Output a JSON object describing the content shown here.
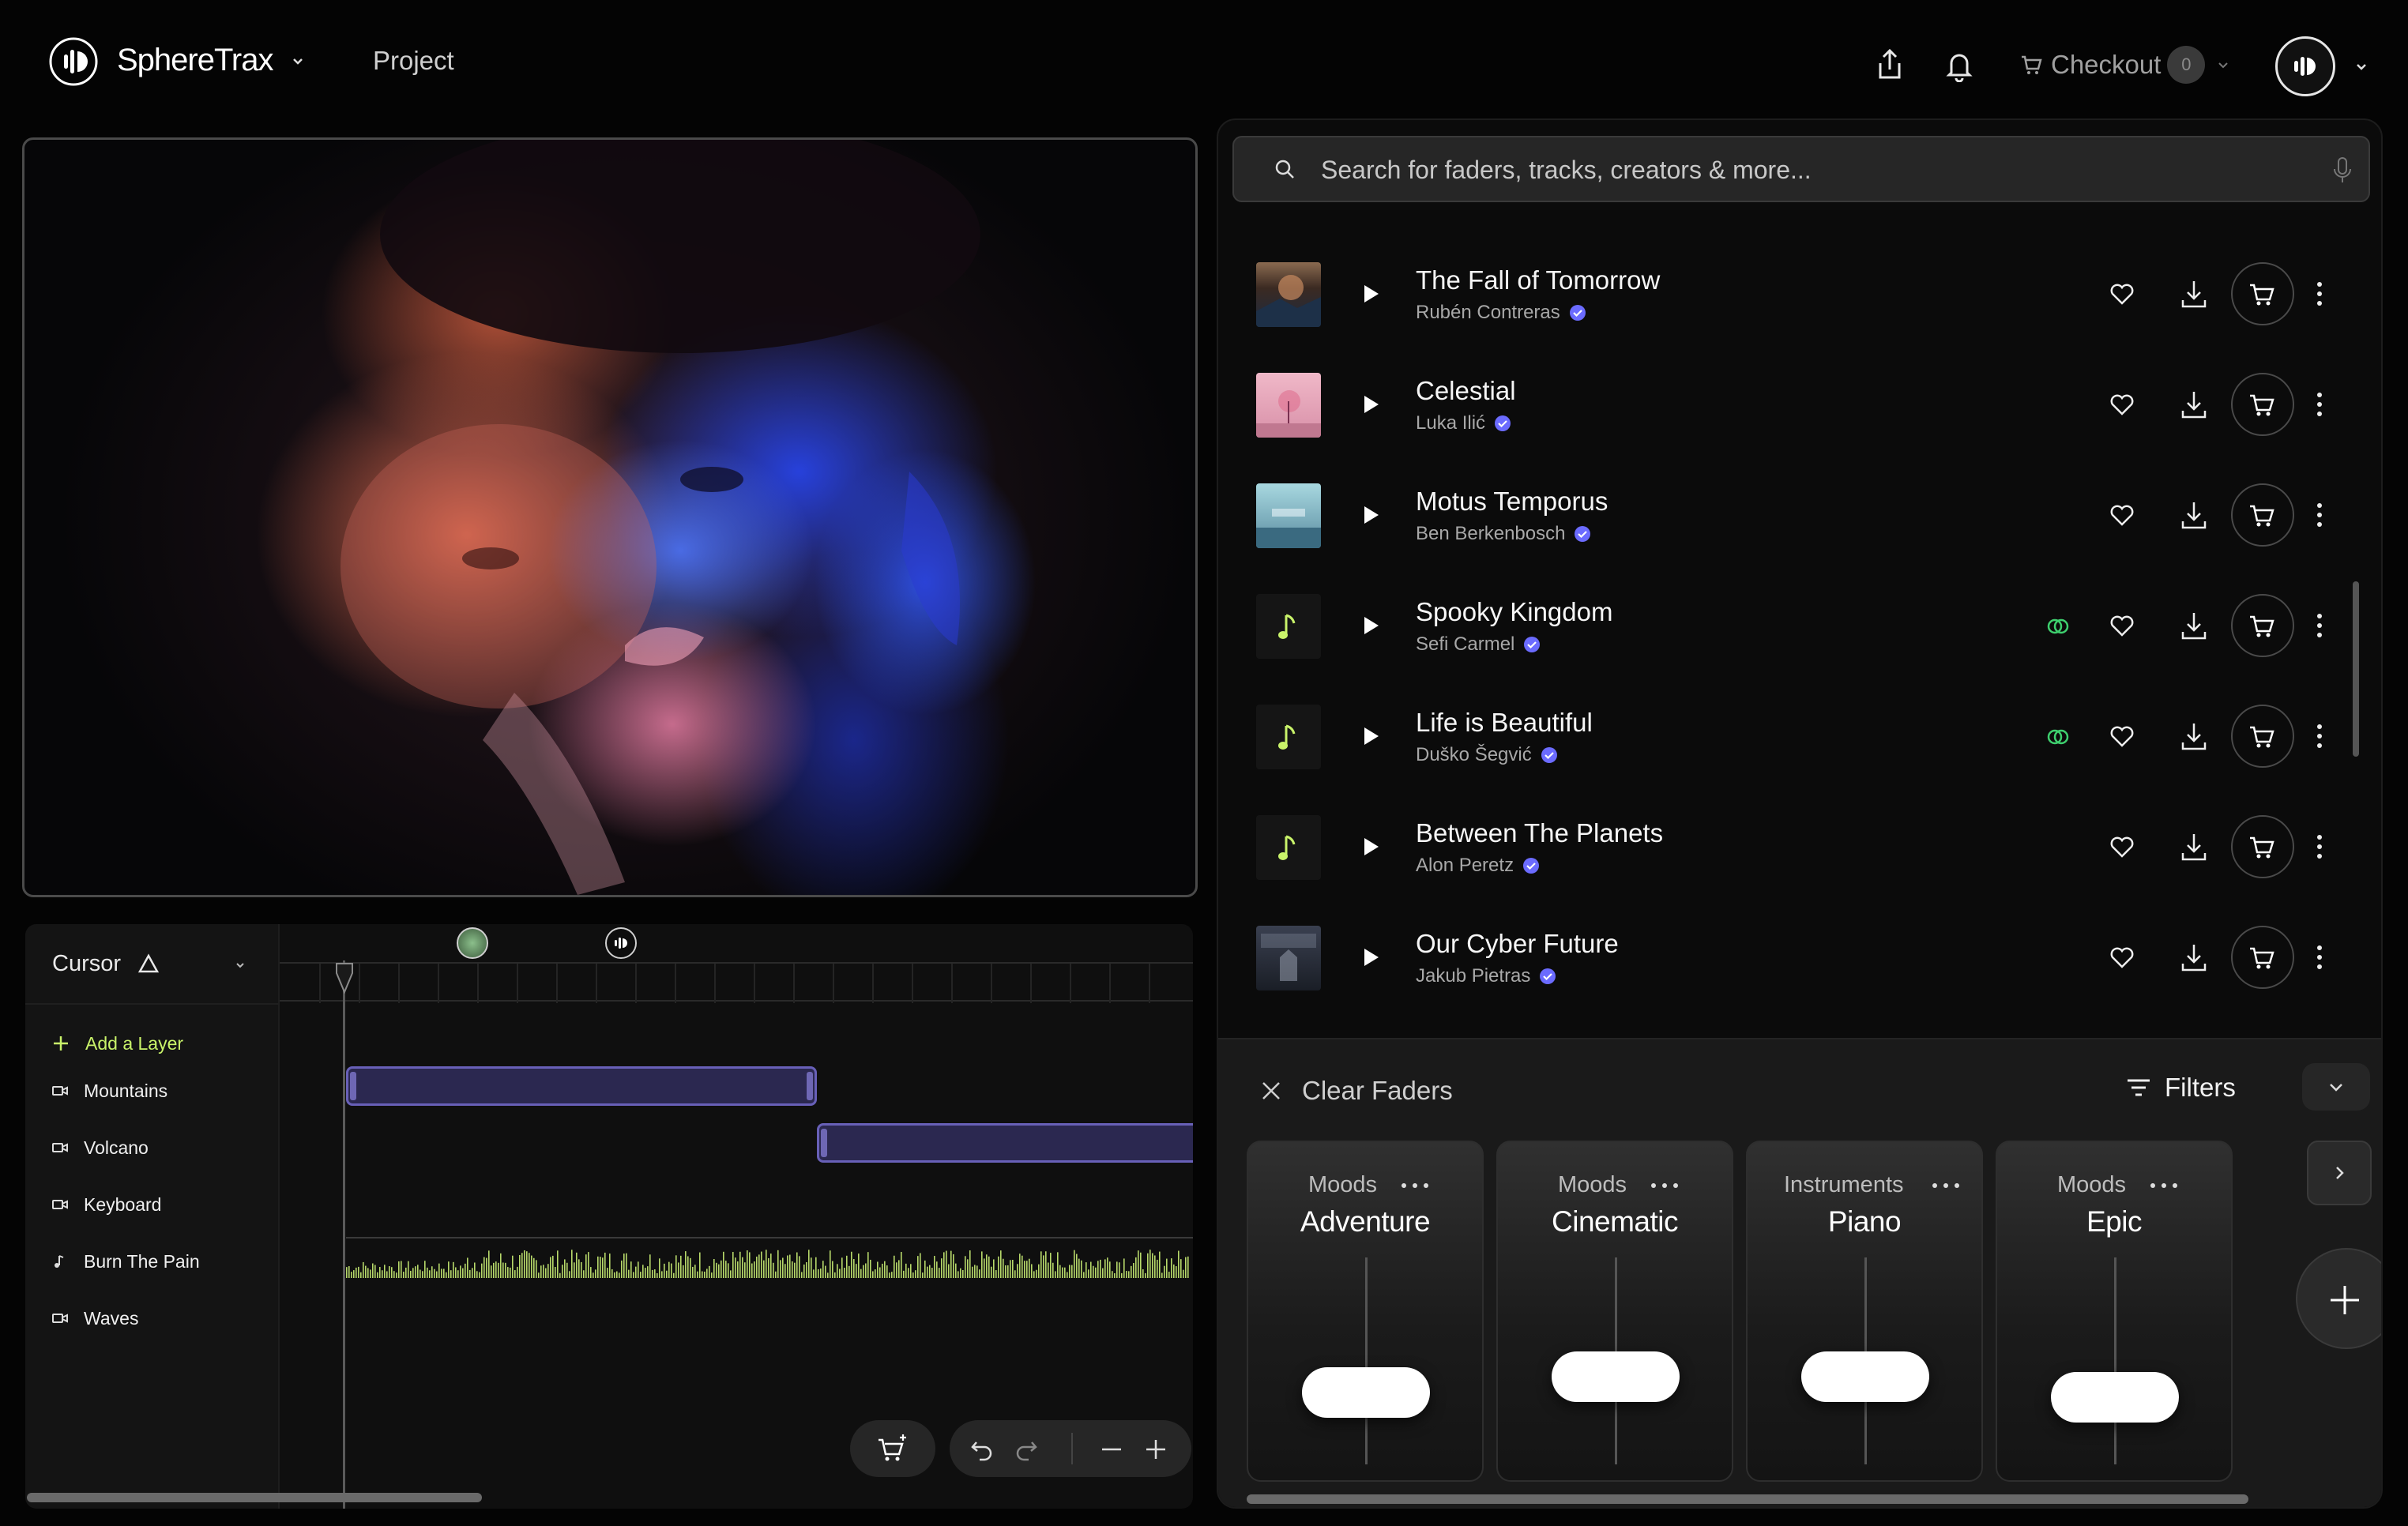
{
  "app": {
    "name": "SphereTrax",
    "nav_project": "Project"
  },
  "header": {
    "checkout_label": "Checkout",
    "checkout_count": "0",
    "icons": [
      "share-icon",
      "bell-icon",
      "cart-icon",
      "avatar"
    ]
  },
  "timeline": {
    "cursor_label": "Cursor",
    "add_layer": "Add a Layer",
    "layers": [
      {
        "label": "Mountains",
        "icon": "video-icon"
      },
      {
        "label": "Volcano",
        "icon": "video-icon"
      },
      {
        "label": "Keyboard",
        "icon": "video-icon"
      },
      {
        "label": "Burn The Pain",
        "icon": "music-note-icon"
      },
      {
        "label": "Waves",
        "icon": "video-icon"
      }
    ]
  },
  "search": {
    "placeholder": "Search for faders, tracks, creators & more..."
  },
  "tracks": [
    {
      "title": "The Fall of Tomorrow",
      "artist": "Rubén Contreras",
      "art": "cover-image",
      "stems": false
    },
    {
      "title": "Celestial",
      "artist": "Luka Ilić",
      "art": "cover-image",
      "stems": false
    },
    {
      "title": "Motus Temporus",
      "artist": "Ben Berkenbosch",
      "art": "cover-image",
      "stems": false
    },
    {
      "title": "Spooky Kingdom",
      "artist": "Sefi Carmel",
      "art": "music-note-icon",
      "stems": true
    },
    {
      "title": "Life is Beautiful",
      "artist": "Duško Šegvić",
      "art": "music-note-icon",
      "stems": true
    },
    {
      "title": "Between The Planets",
      "artist": "Alon Peretz",
      "art": "music-note-icon",
      "stems": false
    },
    {
      "title": "Our Cyber Future",
      "artist": "Jakub Pietras",
      "art": "cover-image",
      "stems": false
    }
  ],
  "faders": {
    "clear_label": "Clear Faders",
    "filters_label": "Filters",
    "cards": [
      {
        "type": "Moods",
        "name": "Adventure",
        "level": 0.3
      },
      {
        "type": "Moods",
        "name": "Cinematic",
        "level": 0.4
      },
      {
        "type": "Instruments",
        "name": "Piano",
        "level": 0.4
      },
      {
        "type": "Moods",
        "name": "Epic",
        "level": 0.27
      }
    ]
  },
  "colors": {
    "accent_green": "#c9f36a",
    "clip_purple": "#6860b8",
    "verified_blue": "#6b6bff",
    "stems_green": "#3ecf6e"
  }
}
